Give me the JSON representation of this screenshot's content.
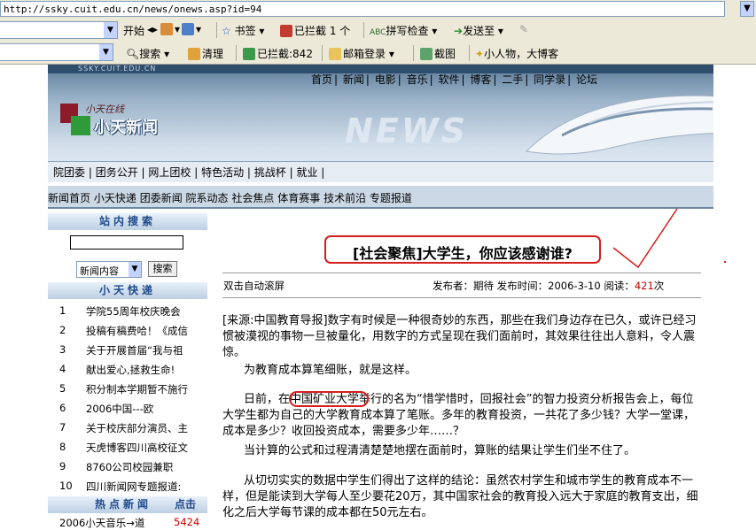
{
  "browser": {
    "url": "http://ssky.cuit.edu.cn/news/onews.asp?id=94",
    "toolbar1": {
      "start": "开始",
      "bookmarks": "书签",
      "blocked": "已拦截 1 个",
      "spellcheck": "拼写检查",
      "send_to": "发送至"
    },
    "toolbar2": {
      "search": "搜索",
      "clean": "清理",
      "blocked_count": "已拦截:842",
      "mail_login": "邮箱登录",
      "screenshot": "截图",
      "blog": "小人物，大博客"
    }
  },
  "site": {
    "url_watermark": "SSKY.CUIT.EDU.CN",
    "logo_small": "小天在线",
    "logo_big": "小天新闻",
    "banner_word": "NEWS",
    "top_nav": [
      "首页",
      "新闻",
      "电影",
      "音乐",
      "软件",
      "博客",
      "二手",
      "同学录",
      "论坛"
    ],
    "sub_nav": [
      "院团委",
      "团务公开",
      "网上团校",
      "特色活动",
      "挑战杯",
      "就业"
    ],
    "category_nav": [
      "新闻首页",
      "小天快递",
      "团委新闻",
      "院系动态",
      "社会焦点",
      "体育赛事",
      "技术前沿",
      "专题报道"
    ]
  },
  "sidebar": {
    "search_title": "站内搜索",
    "search_select": "新闻内容",
    "search_button": "搜索",
    "express_title": "小天快递",
    "express_items": [
      {
        "num": "1",
        "text": "学院55周年校庆晚会"
      },
      {
        "num": "2",
        "text": "投稿有稿费哈！《成信"
      },
      {
        "num": "3",
        "text": "关于开展首届“我与祖"
      },
      {
        "num": "4",
        "text": "献出爱心,拯救生命!"
      },
      {
        "num": "5",
        "text": "积分制本学期暂不施行"
      },
      {
        "num": "6",
        "text": "2006中国---欧"
      },
      {
        "num": "7",
        "text": "关于校庆部分演员、主"
      },
      {
        "num": "8",
        "text": "天虎博客四川高校征文"
      },
      {
        "num": "9",
        "text": "8760公司校园兼职"
      },
      {
        "num": "10",
        "text": "四川新闻网专题报道:"
      }
    ],
    "hot_title": "热点新闻",
    "hot_col": "点击",
    "hot_items": [
      {
        "text": "2006小天音乐→道",
        "clicks": "5424"
      }
    ]
  },
  "article": {
    "headline": "[社会聚焦]大学生，你应该感谢谁?",
    "autoscroll": "双击自动滚屏",
    "meta": "发布者：期待 发布时间：2006-3-10 阅读：",
    "read_count": "421",
    "read_unit": "次",
    "paragraphs": [
      "[来源:中国教育导报]数字有时候是一种很奇妙的东西，那些在我们身边存在已久，或许已经习惯被漠视的事物一旦被量化，用数字的方式呈现在我们面前时，其效果往往出人意料，令人震惊。",
      "为教育成本算笔细账，就是这样。",
      "日前，在中国矿业大学举行的名为“惜学惜时，回报社会”的智力投资分析报告会上，每位大学生都为自己的大学教育成本算了笔账。多年的教育投资，一共花了多少钱？大学一堂课，成本是多少？收回投资成本，需要多少年……？",
      "当计算的公式和过程清清楚楚地摆在面前时，算账的结果让学生们坐不住了。",
      "从切切实实的数据中学生们得出了这样的结论：虽然农村学生和城市学生的教育成本不一样，但是能读到大学每人至少要花20万，其中国家社会的教育投入远大于家庭的教育支出，细化之后大学每节课的成本都在50元左右。"
    ]
  }
}
